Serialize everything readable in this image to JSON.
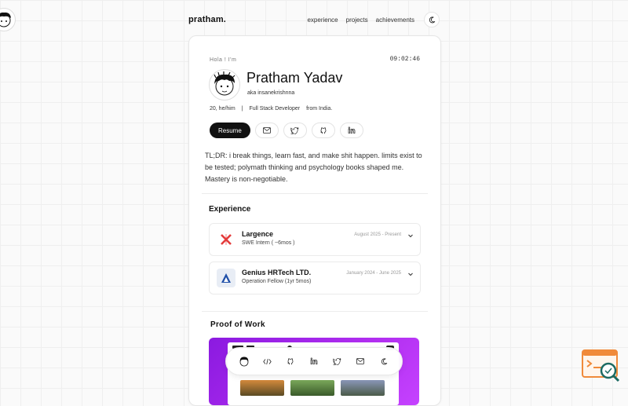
{
  "header": {
    "logo": "pratham.",
    "nav": [
      "experience",
      "projects",
      "achievements"
    ]
  },
  "profile": {
    "greeting": "Hola ! I'm",
    "clock": "09:02:46",
    "name": "Pratham Yadav",
    "aka": "aka insanekrishnna",
    "age_pronouns": "20, he/him",
    "separator": "|",
    "role": "Full Stack Developer",
    "location": "from India.",
    "resume_label": "Resume",
    "bio": "TL;DR: i break things, learn fast, and make shit happen. limits exist to be tested; polymath thinking and psychology books shaped me. Mastery is non-negotiable."
  },
  "experience": {
    "title": "Experience",
    "items": [
      {
        "company": "Largence",
        "role": "SWE Intern ( ~6mos )",
        "date": "August 2025 - Present"
      },
      {
        "company": "Genius HRTech LTD.",
        "role": "Operation Fellow (1yr 5mos)",
        "date": "January 2024 - June 2025"
      }
    ]
  },
  "proof_of_work": {
    "title": "Proof of Work"
  },
  "colors": {
    "accent_purple": "#b12ef0",
    "largence_red": "#e43b3b",
    "genius_blue": "#1f4fa8"
  }
}
